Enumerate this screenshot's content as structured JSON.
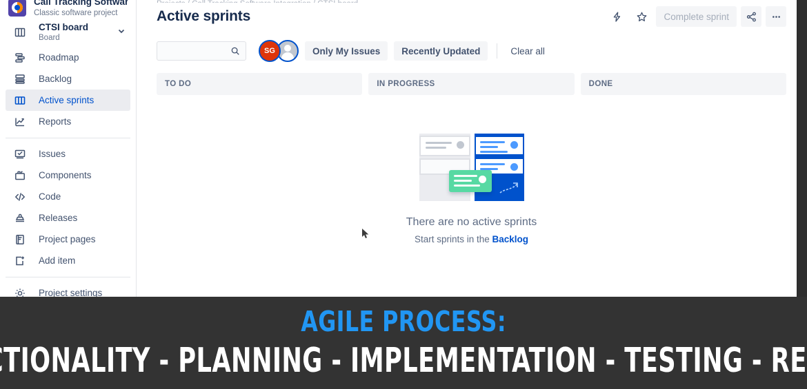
{
  "sidebar": {
    "project": {
      "name": "Call Tracking Software...",
      "subtitle": "Classic software project",
      "avatar_icon": "project-avatar-icon"
    },
    "board": {
      "name": "CTSI board",
      "subtitle": "Board",
      "icon": "board-icon",
      "chevron": "chevron-down-icon"
    },
    "items": [
      {
        "label": "Roadmap",
        "icon": "roadmap-icon",
        "active": false
      },
      {
        "label": "Backlog",
        "icon": "backlog-icon",
        "active": false
      },
      {
        "label": "Active sprints",
        "icon": "board-columns-icon",
        "active": true
      },
      {
        "label": "Reports",
        "icon": "chart-line-icon",
        "active": false
      }
    ],
    "items2": [
      {
        "label": "Issues",
        "icon": "issues-icon"
      },
      {
        "label": "Components",
        "icon": "components-icon"
      },
      {
        "label": "Code",
        "icon": "code-icon"
      },
      {
        "label": "Releases",
        "icon": "releases-icon"
      },
      {
        "label": "Project pages",
        "icon": "pages-icon"
      },
      {
        "label": "Add item",
        "icon": "add-item-icon"
      }
    ],
    "settings": {
      "label": "Project settings",
      "icon": "gear-icon"
    }
  },
  "header": {
    "breadcrumb": "Projects / Call Tracking Software Integration / CTSI board",
    "title": "Active sprints",
    "actions": {
      "feedback_icon": "lightning-icon",
      "star_icon": "star-icon",
      "complete_sprint_label": "Complete sprint",
      "share_icon": "share-icon",
      "more_icon": "more-horizontal-icon"
    }
  },
  "filters": {
    "search": {
      "value": "",
      "placeholder": "",
      "icon": "search-icon"
    },
    "avatars": [
      {
        "initials": "SG",
        "color": "#DE350B",
        "ring": "#0052CC"
      },
      {
        "initials": "",
        "color": "#C1C7D0",
        "ring": "#0052CC"
      }
    ],
    "chips": [
      {
        "label": "Only My Issues"
      },
      {
        "label": "Recently Updated"
      }
    ],
    "clear_all_label": "Clear all"
  },
  "board": {
    "columns": [
      {
        "title": "TO DO"
      },
      {
        "title": "IN PROGRESS"
      },
      {
        "title": "DONE"
      }
    ]
  },
  "empty_state": {
    "illustration": "empty-board-illustration",
    "title": "There are no active sprints",
    "subtitle_prefix": "Start sprints in the ",
    "subtitle_link": "Backlog"
  },
  "banner": {
    "title": "AGILE PROCESS:",
    "subtitle": "FUNCTIONALITY - PLANNING - IMPLEMENTATION - TESTING - REVIEW",
    "title_color": "#2196F3",
    "subtitle_color": "#FFFFFF",
    "background": "#333333"
  },
  "colors": {
    "accent_blue": "#0052CC",
    "text_dark": "#172B4D",
    "text_muted": "#6B778C",
    "surface_gray": "#F4F5F7",
    "active_bg": "#EBECF0",
    "green_card": "#57D9A3"
  }
}
